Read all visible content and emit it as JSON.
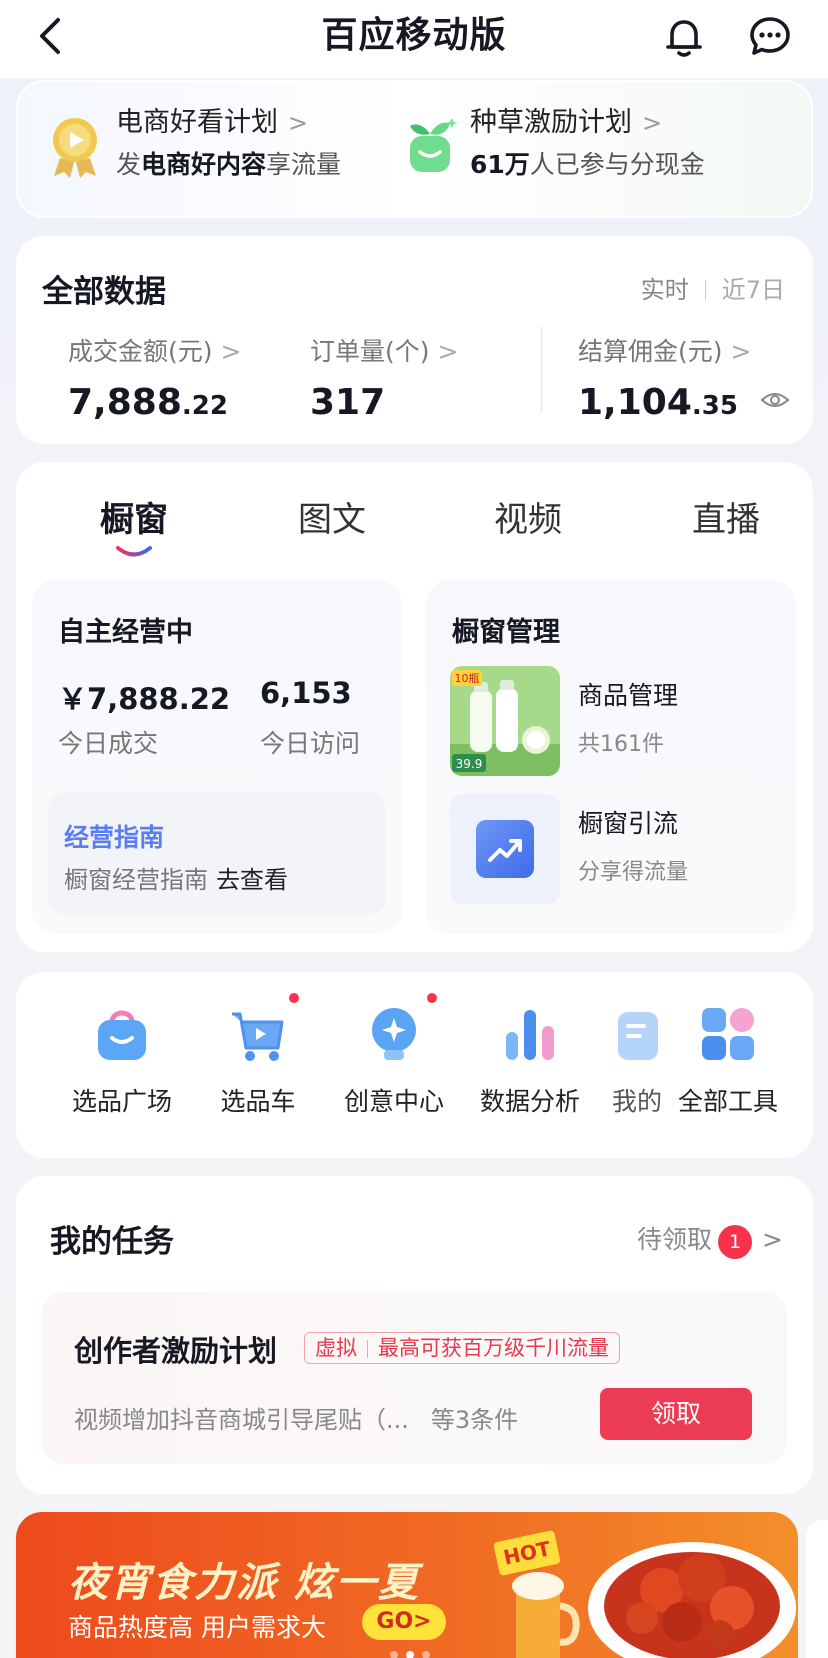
{
  "nav": {
    "title": "百应移动版"
  },
  "promo": {
    "left": {
      "title": "电商好看计划",
      "sub_pre": "发",
      "sub_bold": "电商好内容",
      "sub_post": "享流量"
    },
    "right": {
      "title": "种草激励计划",
      "sub_bold": "61万",
      "sub_post": "人已参与分现金"
    }
  },
  "data_panel": {
    "title": "全部数据",
    "range_realtime": "实时",
    "range_7d": "近7日",
    "metrics": [
      {
        "label": "成交金额(元)",
        "int": "7,888",
        "dec": ".22"
      },
      {
        "label": "订单量(个)",
        "int": "317",
        "dec": ""
      },
      {
        "label": "结算佣金(元)",
        "int": "1,104",
        "dec": ".35"
      }
    ]
  },
  "showcase": {
    "tabs": [
      "橱窗",
      "图文",
      "视频",
      "直播"
    ],
    "active_tab": "橱窗",
    "self_run": {
      "title": "自主经营中",
      "sales": "￥7,888.22",
      "sales_label": "今日成交",
      "visits": "6,153",
      "visits_label": "今日访问",
      "guide_title": "经营指南",
      "guide_desc": "橱窗经营指南",
      "guide_link": "去查看"
    },
    "manage": {
      "title": "橱窗管理",
      "items": [
        {
          "title": "商品管理",
          "sub": "共161件"
        },
        {
          "title": "橱窗引流",
          "sub": "分享得流量"
        }
      ],
      "product_price": "39.9",
      "product_badge": "10瓶"
    }
  },
  "tools": [
    {
      "label": "选品广场",
      "icon": "shopping-bag-icon",
      "dot": false
    },
    {
      "label": "选品车",
      "icon": "cart-icon",
      "dot": true
    },
    {
      "label": "创意中心",
      "icon": "lightbulb-icon",
      "dot": true
    },
    {
      "label": "数据分析",
      "icon": "bar-chart-icon",
      "dot": false
    },
    {
      "label": "我的",
      "icon": "document-icon",
      "dot": false
    },
    {
      "label": "全部工具",
      "icon": "grid-icon",
      "dot": false
    }
  ],
  "tasks": {
    "title": "我的任务",
    "pending_label": "待领取",
    "pending_count": "1",
    "item": {
      "title": "创作者激励计划",
      "tag1": "虚拟",
      "tag2": "最高可获百万级千川流量",
      "desc": "视频增加抖音商城引导尾贴（...",
      "conditions": "等3条件",
      "button": "领取"
    }
  },
  "ad": {
    "headline": "夜宵食力派 炫一夏",
    "sub": "商品热度高 用户需求大",
    "go": "GO>",
    "hot": "HOT"
  },
  "colors": {
    "accent_red": "#ec3c55",
    "guide_blue": "#5a7ef2",
    "ad_orange": "#ee4a1c"
  }
}
